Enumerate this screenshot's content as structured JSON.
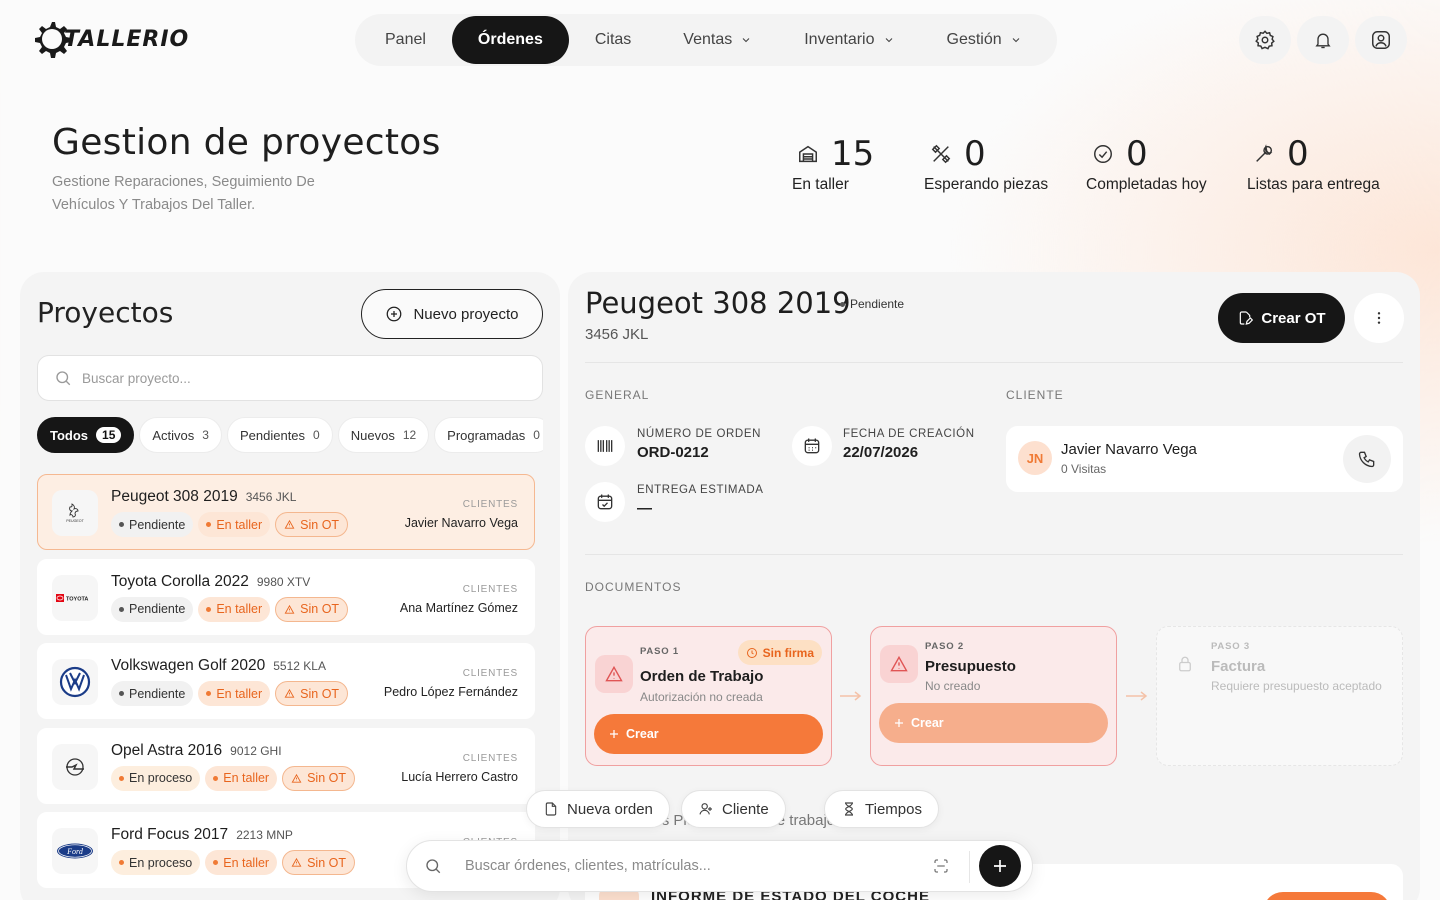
{
  "app": {
    "logo_text": "TALLERIO"
  },
  "nav": [
    {
      "label": "Panel",
      "dropdown": false,
      "active": false
    },
    {
      "label": "Órdenes",
      "dropdown": false,
      "active": true
    },
    {
      "label": "Citas",
      "dropdown": false,
      "active": false
    },
    {
      "label": "Ventas",
      "dropdown": true,
      "active": false
    },
    {
      "label": "Inventario",
      "dropdown": true,
      "active": false
    },
    {
      "label": "Gestión",
      "dropdown": true,
      "active": false
    }
  ],
  "header_icons": [
    "gear-icon",
    "bell-icon",
    "user-icon"
  ],
  "page": {
    "title": "Gestion de proyectos",
    "subtitle": "Gestione Reparaciones, Seguimiento De Vehículos Y Trabajos Del Taller."
  },
  "stats": [
    {
      "value": "15",
      "label": "En taller",
      "icon": "garage-icon"
    },
    {
      "value": "0",
      "label": "Esperando piezas",
      "icon": "tools-icon"
    },
    {
      "value": "0",
      "label": "Completadas hoy",
      "icon": "check-circle-icon"
    },
    {
      "value": "0",
      "label": "Listas para entrega",
      "icon": "wrench-icon"
    }
  ],
  "projects_panel": {
    "title": "Proyectos",
    "new_button": "Nuevo proyecto",
    "search_placeholder": "Buscar proyecto...",
    "filters": [
      {
        "label": "Todos",
        "count": "15",
        "active": true
      },
      {
        "label": "Activos",
        "count": "3",
        "active": false
      },
      {
        "label": "Pendientes",
        "count": "0",
        "active": false
      },
      {
        "label": "Nuevos",
        "count": "12",
        "active": false
      },
      {
        "label": "Programadas",
        "count": "0",
        "active": false
      }
    ],
    "client_label": "CLIENTES",
    "projects": [
      {
        "name": "Peugeot 308 2019",
        "plate": "3456 JKL",
        "status": "Pendiente",
        "location": "En taller",
        "ot": "Sin OT",
        "client": "Javier Navarro Vega",
        "brand": "peugeot-logo",
        "selected": true
      },
      {
        "name": "Toyota Corolla 2022",
        "plate": "9980 XTV",
        "status": "Pendiente",
        "location": "En taller",
        "ot": "Sin OT",
        "client": "Ana Martínez Gómez",
        "brand": "toyota-logo",
        "selected": false
      },
      {
        "name": "Volkswagen Golf 2020",
        "plate": "5512 KLA",
        "status": "Pendiente",
        "location": "En taller",
        "ot": "Sin OT",
        "client": "Pedro López Fernández",
        "brand": "volkswagen-logo",
        "selected": false
      },
      {
        "name": "Opel Astra 2016",
        "plate": "9012 GHI",
        "status": "En proceso",
        "location": "En taller",
        "ot": "Sin OT",
        "client": "Lucía Herrero Castro",
        "brand": "opel-logo",
        "selected": false
      },
      {
        "name": "Ford Focus 2017",
        "plate": "2213 MNP",
        "status": "En proceso",
        "location": "En taller",
        "ot": "Sin OT",
        "client": "",
        "brand": "ford-logo",
        "selected": false
      }
    ]
  },
  "detail": {
    "title": "Peugeot 308 2019",
    "status": "Pendiente",
    "plate": "3456 JKL",
    "create_ot": "Crear OT",
    "general_label": "GENERAL",
    "client_label": "CLIENTE",
    "fields": {
      "order_label": "NÚMERO DE ORDEN",
      "order_value": "ORD-0212",
      "created_label": "FECHA DE CREACIÓN",
      "created_value": "22/07/2026",
      "delivery_label": "ENTREGA ESTIMADA",
      "delivery_value": "—"
    },
    "client": {
      "initials": "JN",
      "name": "Javier Navarro Vega",
      "visits": "0 Visitas"
    },
    "documents_label": "DOCUMENTOS",
    "steps": [
      {
        "paso": "PASO 1",
        "title": "Orden de Trabajo",
        "subtitle": "Autorización no creada",
        "badge": "Sin firma",
        "button": "Crear"
      },
      {
        "paso": "PASO 2",
        "title": "Presupuesto",
        "subtitle": "No creado",
        "button": "Crear"
      },
      {
        "paso": "PASO 3",
        "title": "Factura",
        "subtitle": "Requiere presupuesto aceptado"
      }
    ],
    "tabs_behind": "Documentos   Piezas   Orden de trabajo",
    "report_title": "INFORME DE ESTADO DEL COCHE"
  },
  "quick_actions": [
    "Nueva orden",
    "Cliente",
    "Tiempos"
  ],
  "bottom_search": {
    "placeholder": "Buscar órdenes, clientes, matrículas..."
  },
  "colors": {
    "accent": "#f5793a",
    "dark": "#161616",
    "danger_bg": "#fbeaea"
  }
}
